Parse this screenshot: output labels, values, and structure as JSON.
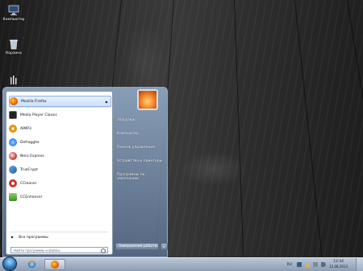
{
  "desktop": {
    "icons": [
      {
        "label": "Компьютер",
        "icon": "computer-icon"
      },
      {
        "label": "Корзина",
        "icon": "recycle-bin-icon"
      },
      {
        "label": "",
        "icon": "network-icon"
      }
    ]
  },
  "start_menu": {
    "programs": [
      {
        "name": "Mozilla Firefox",
        "icon": "firefox-icon",
        "color": "#e66000",
        "has_submenu": true,
        "selected": true
      },
      {
        "name": "Media Player Classic",
        "icon": "media-player-icon",
        "color": "#222222",
        "has_submenu": false
      },
      {
        "name": "AIMP3",
        "icon": "aimp-icon",
        "color": "#f5a623",
        "has_submenu": false
      },
      {
        "name": "Defraggler",
        "icon": "defraggler-icon",
        "color": "#2b7de9",
        "has_submenu": false
      },
      {
        "name": "Nero Express",
        "icon": "nero-icon",
        "color": "#c0392b",
        "has_submenu": false
      },
      {
        "name": "TrueCrypt",
        "icon": "truecrypt-icon",
        "color": "#1f5fa8",
        "has_submenu": false
      },
      {
        "name": "CCleaner",
        "icon": "ccleaner-icon",
        "color": "#d0342c",
        "has_submenu": false
      },
      {
        "name": "CCEnhancer",
        "icon": "ccenhancer-icon",
        "color": "#4caf50",
        "has_submenu": false
      }
    ],
    "all_programs_label": "Все программы",
    "search_placeholder": "Найти программы и файлы",
    "right_items": [
      {
        "label": "Загрузки"
      },
      {
        "label": "Компьютер"
      },
      {
        "label": "Панель управления"
      },
      {
        "label": "Устройства и принтеры"
      },
      {
        "label": "Программы по умолчанию"
      }
    ],
    "shutdown_label": "Завершение работы",
    "shutdown_arrow": "▸"
  },
  "taskbar": {
    "pinned": [
      {
        "name": "Internet Explorer",
        "icon": "internet-explorer-icon"
      },
      {
        "name": "Firefox",
        "icon": "firefox-icon"
      }
    ],
    "tray": {
      "language": "RU",
      "time": "13:34",
      "date": "12.08.2013"
    }
  },
  "colors": {
    "accent": "#2a6fb0",
    "menu_glass": "#8fa8c8"
  }
}
